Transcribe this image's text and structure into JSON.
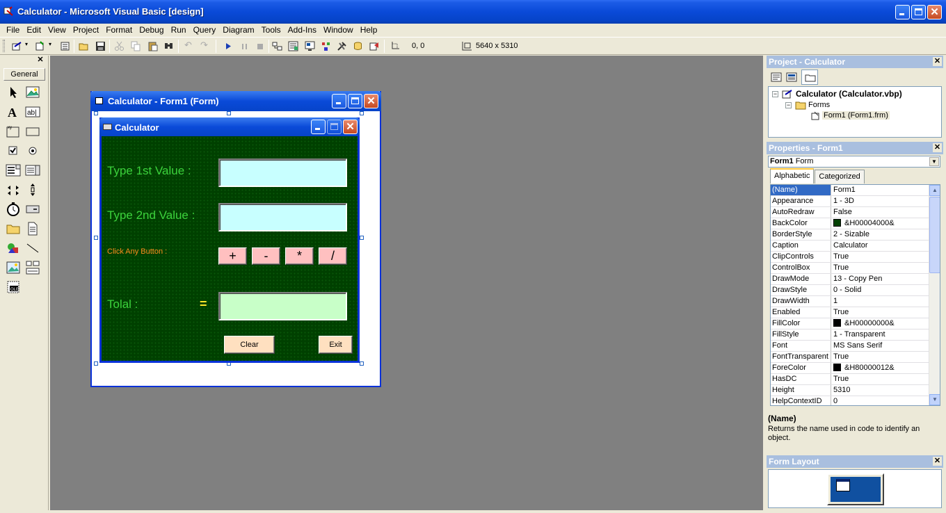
{
  "window": {
    "title": "Calculator - Microsoft Visual Basic [design]"
  },
  "menu": [
    "File",
    "Edit",
    "View",
    "Project",
    "Format",
    "Debug",
    "Run",
    "Query",
    "Diagram",
    "Tools",
    "Add-Ins",
    "Window",
    "Help"
  ],
  "toolbar": {
    "position": "0, 0",
    "size": "5640 x 5310"
  },
  "toolbox": {
    "tab_label": "General",
    "tools": [
      "pointer-icon",
      "picturebox-icon",
      "label-icon",
      "textbox-icon",
      "frame-icon",
      "commandbutton-icon",
      "checkbox-icon",
      "optionbutton-icon",
      "combobox-icon",
      "listbox-icon",
      "hscrollbar-icon",
      "vscrollbar-icon",
      "timer-icon",
      "drivelistbox-icon",
      "dirlistbox-icon",
      "filelistbox-icon",
      "shape-icon",
      "line-icon",
      "image-icon",
      "data-icon",
      "ole-icon"
    ]
  },
  "designer": {
    "title": "Calculator - Form1 (Form)",
    "form": {
      "caption": "Calculator",
      "label1": "Type 1st Value :",
      "label2": "Type 2nd Value :",
      "label3": "Click Any Button :",
      "label_total": "Tolal :",
      "equals": "=",
      "ops": [
        "+",
        "-",
        "*",
        "/"
      ],
      "clear": "Clear",
      "exit": "Exit"
    }
  },
  "project_panel": {
    "title": "Project - Calculator",
    "root": "Calculator (Calculator.vbp)",
    "folder": "Forms",
    "file": "Form1 (Form1.frm)"
  },
  "properties_panel": {
    "title": "Properties - Form1",
    "object_name": "Form1",
    "object_type": "Form",
    "tabs": [
      "Alphabetic",
      "Categorized"
    ],
    "rows": [
      {
        "name": "(Name)",
        "value": "Form1"
      },
      {
        "name": "Appearance",
        "value": "1 - 3D"
      },
      {
        "name": "AutoRedraw",
        "value": "False"
      },
      {
        "name": "BackColor",
        "value": "&H00004000&",
        "swatch": "#004000"
      },
      {
        "name": "BorderStyle",
        "value": "2 - Sizable"
      },
      {
        "name": "Caption",
        "value": "Calculator"
      },
      {
        "name": "ClipControls",
        "value": "True"
      },
      {
        "name": "ControlBox",
        "value": "True"
      },
      {
        "name": "DrawMode",
        "value": "13 - Copy Pen"
      },
      {
        "name": "DrawStyle",
        "value": "0 - Solid"
      },
      {
        "name": "DrawWidth",
        "value": "1"
      },
      {
        "name": "Enabled",
        "value": "True"
      },
      {
        "name": "FillColor",
        "value": "&H00000000&",
        "swatch": "#000000"
      },
      {
        "name": "FillStyle",
        "value": "1 - Transparent"
      },
      {
        "name": "Font",
        "value": "MS Sans Serif"
      },
      {
        "name": "FontTransparent",
        "value": "True"
      },
      {
        "name": "ForeColor",
        "value": "&H80000012&",
        "swatch": "#000000"
      },
      {
        "name": "HasDC",
        "value": "True"
      },
      {
        "name": "Height",
        "value": "5310"
      },
      {
        "name": "HelpContextID",
        "value": "0"
      }
    ],
    "desc_name": "(Name)",
    "desc_text": "Returns the name used in code to identify an object."
  },
  "layout_panel": {
    "title": "Form Layout"
  }
}
